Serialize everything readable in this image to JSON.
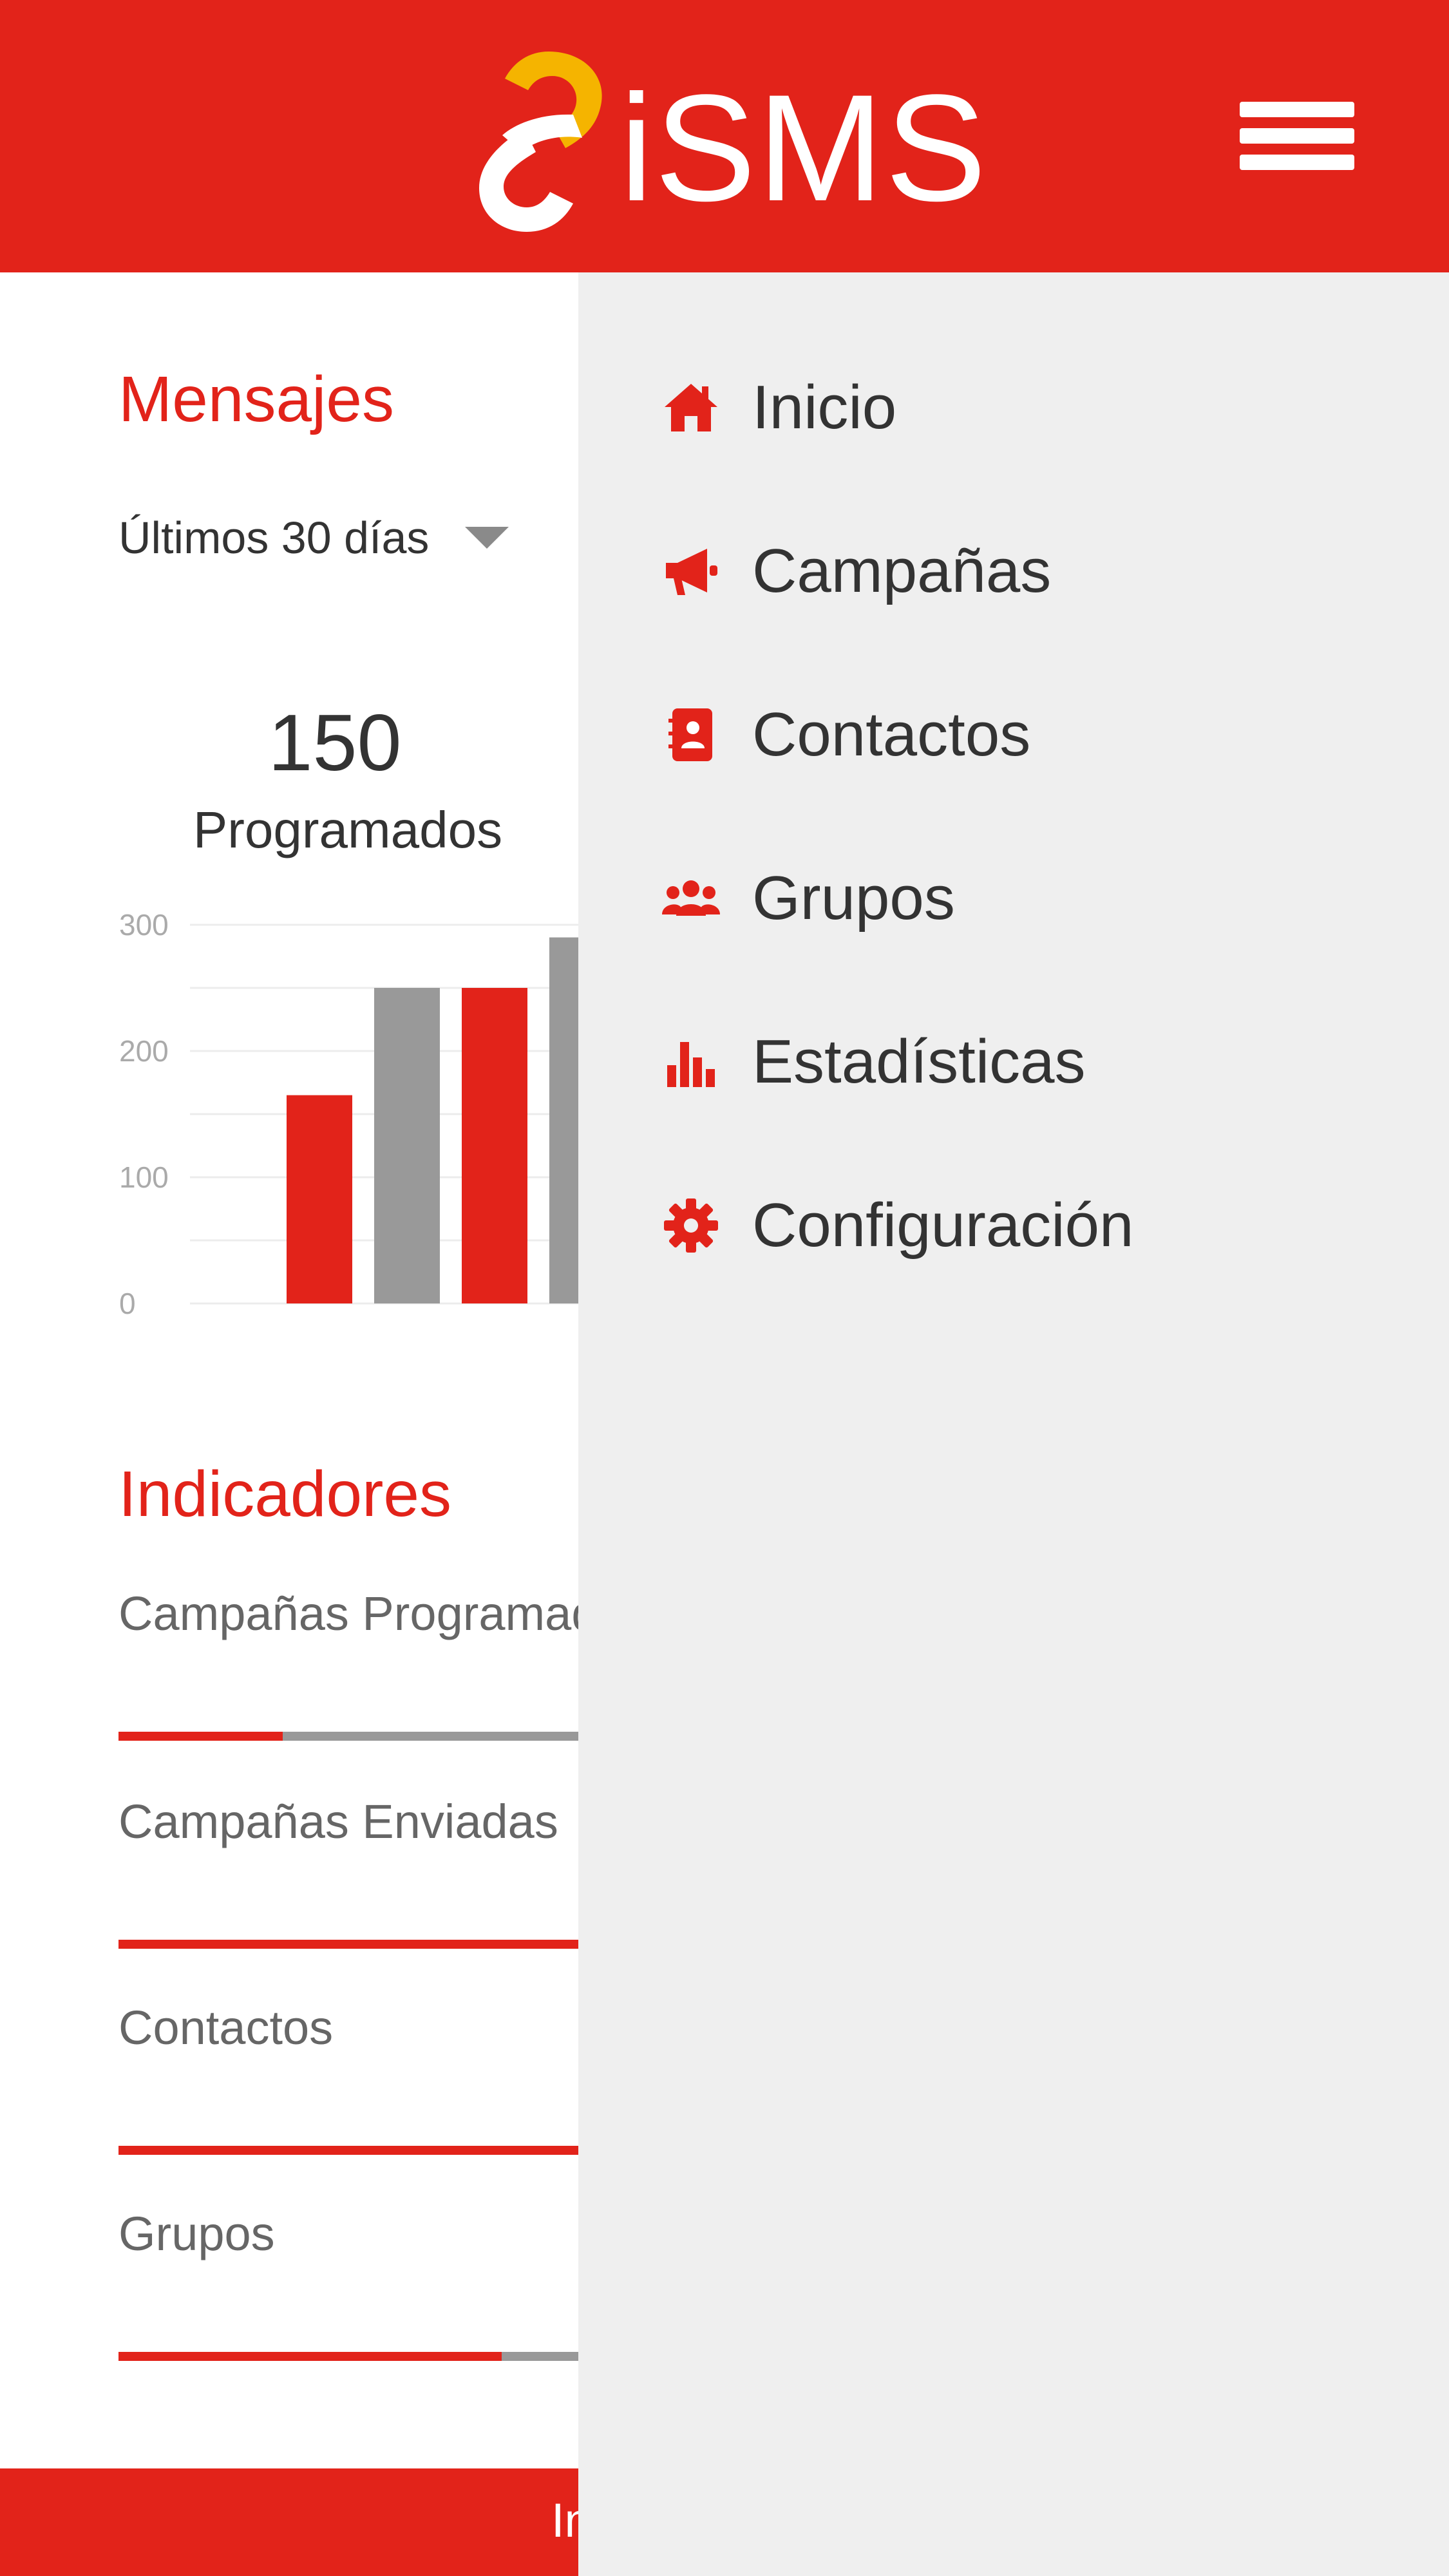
{
  "header": {
    "logo_text": "iSMS",
    "menu_icon": "hamburger-icon"
  },
  "main": {
    "messages_title": "Mensajes",
    "range_selected": "Últimos 30 días",
    "range_icon": "caret-down-icon",
    "stat_value": "150",
    "stat_label": "Programados",
    "indicators_title": "Indicadores",
    "indicators": [
      {
        "label": "Campañas Programadas",
        "progress": 0.15
      },
      {
        "label": "Campañas Enviadas",
        "progress": 1.0
      },
      {
        "label": "Contactos",
        "progress": 1.0
      },
      {
        "label": "Grupos",
        "progress": 0.35
      }
    ]
  },
  "footer": {
    "text": "In"
  },
  "drawer": {
    "items": [
      {
        "label": "Inicio",
        "icon": "home-icon"
      },
      {
        "label": "Campañas",
        "icon": "megaphone-icon"
      },
      {
        "label": "Contactos",
        "icon": "address-book-icon"
      },
      {
        "label": "Grupos",
        "icon": "users-icon"
      },
      {
        "label": "Estadísticas",
        "icon": "bar-chart-icon"
      },
      {
        "label": "Configuración",
        "icon": "gear-icon"
      }
    ]
  },
  "colors": {
    "brand_red": "#e2231a",
    "logo_yellow": "#f5b400",
    "series_gray": "#999999",
    "drawer_bg": "#efefef"
  },
  "chart_data": {
    "type": "bar",
    "ylim": [
      0,
      300
    ],
    "yticks": [
      "0",
      "100",
      "200",
      "300"
    ],
    "grid": true,
    "series_colors": [
      "#e2231a",
      "#999999"
    ],
    "values_visible": [
      165,
      250,
      250,
      290
    ]
  }
}
